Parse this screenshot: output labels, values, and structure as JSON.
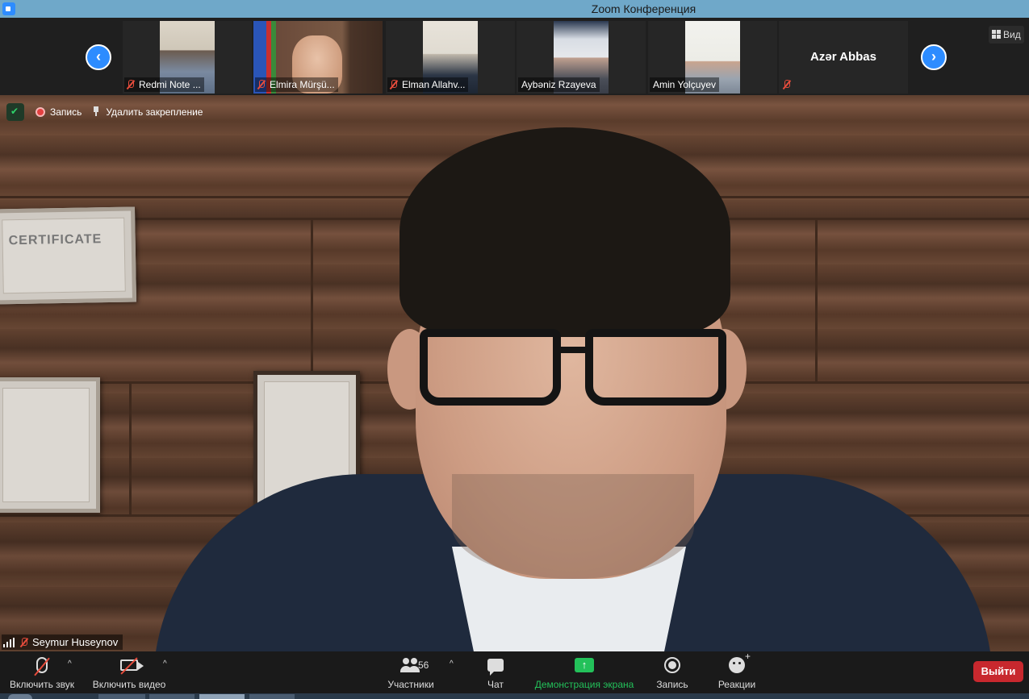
{
  "window": {
    "title": "Zoom Конференция"
  },
  "strip": {
    "view_label": "Вид",
    "participants": [
      {
        "name": "Redmi Note ...",
        "muted": true,
        "has_video": true
      },
      {
        "name": "Elmira Mürşü...",
        "muted": true,
        "has_video": true
      },
      {
        "name": "Elman Allahv...",
        "muted": true,
        "has_video": true
      },
      {
        "name": "Aybəniz Rzayeva",
        "muted": false,
        "has_video": true
      },
      {
        "name": "Amin Yolçuyev",
        "muted": false,
        "has_video": true
      },
      {
        "name": "Azər Abbas",
        "muted": true,
        "has_video": false
      }
    ]
  },
  "main": {
    "certificate_text": "CERTIFICATE",
    "record_label": "Запись",
    "unpin_label": "Удалить закрепление",
    "speaker_name": "Seymur Huseynov"
  },
  "toolbar": {
    "unmute_label": "Включить звук",
    "start_video_label": "Включить видео",
    "participants_label": "Участники",
    "participants_count": "56",
    "chat_label": "Чат",
    "share_label": "Демонстрация экрана",
    "share_icon": "↑",
    "record_label": "Запись",
    "reactions_label": "Реакции",
    "leave_label": "Выйти",
    "caret": "^"
  },
  "nav": {
    "prev": "‹",
    "next": "›"
  },
  "colors": {
    "accent": "#2d8cff",
    "share_green": "#23c15a",
    "leave_red": "#c8282e",
    "muted_red": "#e74c3c"
  }
}
